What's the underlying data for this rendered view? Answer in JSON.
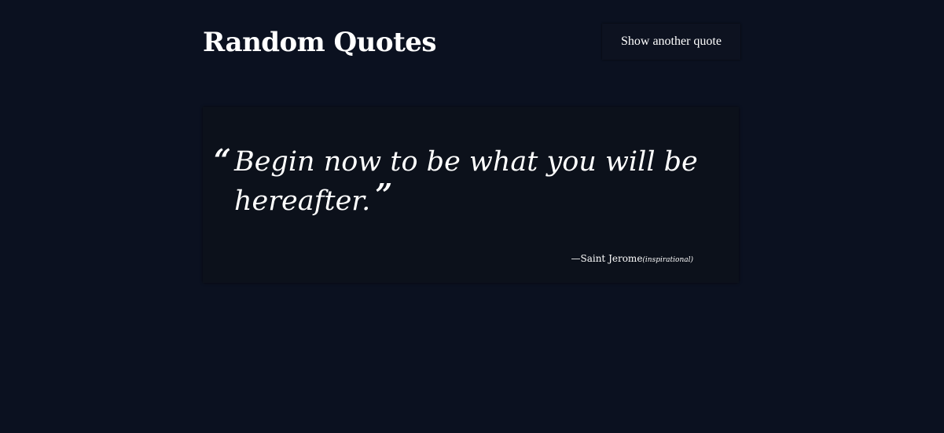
{
  "header": {
    "title": "Random Quotes",
    "new_quote_label": "Show another quote"
  },
  "quote": {
    "open_mark": "“",
    "text": "Begin now to be what you will be hereafter.",
    "close_mark": "”",
    "dash": "—",
    "author": "Saint Jerome",
    "category": "(inspirational)"
  },
  "colors": {
    "background": "#0b1120",
    "card": "#0c111b",
    "text": "#ffffff"
  }
}
